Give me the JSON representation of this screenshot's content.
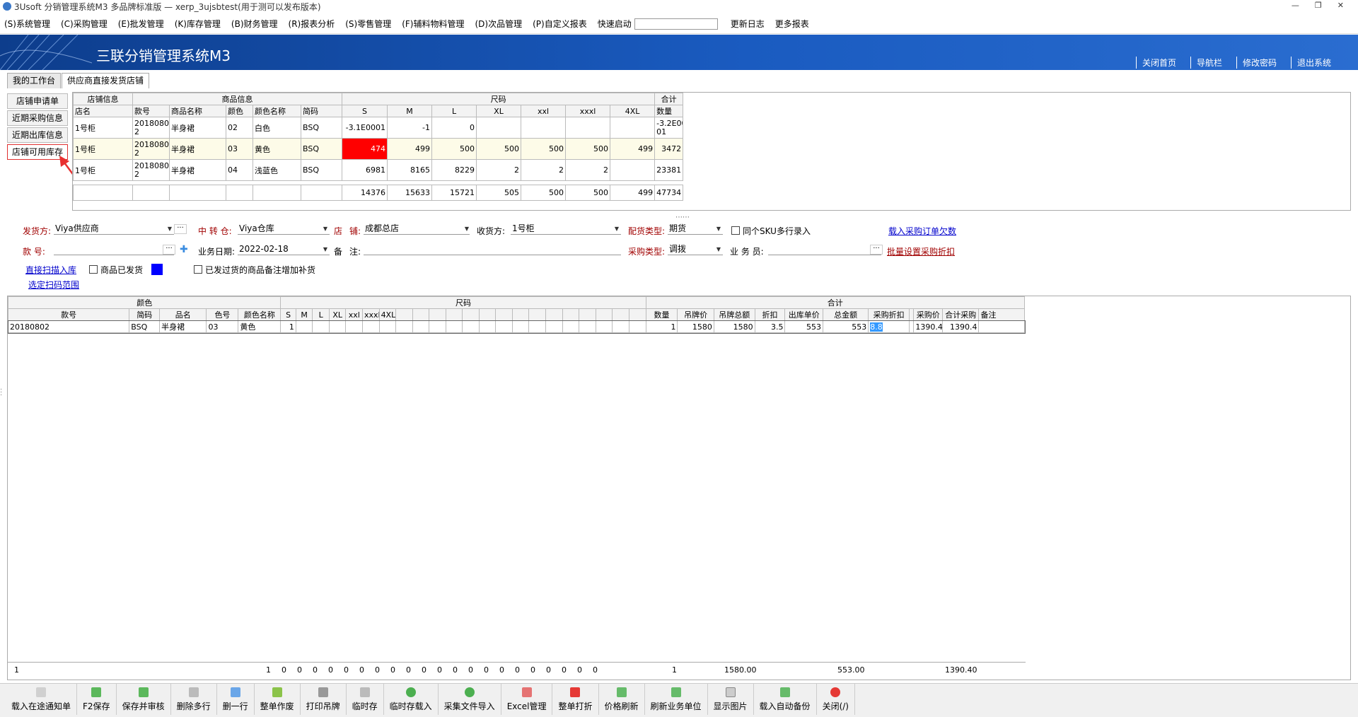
{
  "window": {
    "title": "3Usoft 分销管理系统M3 多品牌标准版 — xerp_3ujsbtest(用于测可以发布版本)"
  },
  "menu": {
    "items": [
      "(S)系统管理",
      "(C)采购管理",
      "(E)批发管理",
      "(K)库存管理",
      "(B)财务管理",
      "(R)报表分析",
      "(S)零售管理",
      "(F)辅料物料管理",
      "(D)次品管理",
      "(P)自定义报表"
    ],
    "quick_start": "快速启动",
    "update_log": "更新日志",
    "more_reports": "更多报表"
  },
  "banner": {
    "title": "三联分销管理系统M3",
    "links": [
      "关闭首页",
      "导航栏",
      "修改密码",
      "退出系统"
    ]
  },
  "tabs": [
    "我的工作台",
    "供应商直接发货店铺"
  ],
  "side": {
    "buttons": [
      "店铺申请单",
      "近期采购信息",
      "近期出库信息",
      "店铺可用库存"
    ],
    "selected": 3
  },
  "stock_grid": {
    "groups": [
      "店铺信息",
      "商品信息",
      "尺码",
      "合计"
    ],
    "headers": [
      "店名",
      "款号",
      "商品名称",
      "颜色",
      "颜色名称",
      "简码",
      "S",
      "M",
      "L",
      "XL",
      "xxl",
      "xxxl",
      "4XL",
      "数量"
    ],
    "rows": [
      [
        "1号柜",
        "2018080\n2",
        "半身裙",
        "02",
        "白色",
        "BSQ",
        "-3.1E0001",
        "-1",
        "0",
        "",
        "",
        "",
        "",
        "-3.2E00\n01"
      ],
      [
        "1号柜",
        "2018080\n2",
        "半身裙",
        "03",
        "黄色",
        "BSQ",
        "474",
        "499",
        "500",
        "500",
        "500",
        "500",
        "499",
        "3472"
      ],
      [
        "1号柜",
        "2018080\n2",
        "半身裙",
        "04",
        "浅蓝色",
        "BSQ",
        "6981",
        "8165",
        "8229",
        "2",
        "2",
        "2",
        "",
        "23381"
      ]
    ],
    "totals": [
      "",
      "",
      "",
      "",
      "",
      "",
      "14376",
      "15633",
      "15721",
      "505",
      "500",
      "500",
      "499",
      "47734"
    ]
  },
  "form": {
    "shipper_label": "发货方:",
    "shipper_value": "Viya供应商",
    "transit_label": "中 转 仓:",
    "transit_value": "Viya仓库",
    "store_label": "店",
    "store_label2": "铺:",
    "store_value": "成都总店",
    "receiver_label": "收货方:",
    "receiver_value": "1号柜",
    "dist_type_label": "配货类型:",
    "dist_type_value": "期货",
    "sku_multi_label": "同个SKU多行录入",
    "load_order_link": "载入采购订单欠数",
    "style_label": "款     号:",
    "style_value": "",
    "biz_date_label": "业务日期:",
    "biz_date_value": "2022-02-18",
    "remark_label": "备",
    "remark_label2": "注:",
    "remark_value": "",
    "purchase_type_label": "采购类型:",
    "purchase_type_value": "调拨",
    "clerk_label": "业 务 员:",
    "clerk_value": "",
    "batch_discount_link": "批量设置采购折扣",
    "scan_link": "直接扫描入库",
    "shipped_label": "商品已发货",
    "replenish_label": "已发过货的商品备注增加补货",
    "scan_range_link": "选定扫码范围"
  },
  "main_grid": {
    "groups": [
      "颜色",
      "尺码",
      "合计"
    ],
    "headers": [
      "款号",
      "简码",
      "品名",
      "色号",
      "颜色名称",
      "S",
      "M",
      "L",
      "XL",
      "xxl",
      "xxxl",
      "4XL",
      "",
      "",
      "",
      "",
      "",
      "",
      "",
      "",
      "",
      "",
      "",
      "",
      "",
      "",
      "",
      "数量",
      "吊牌价",
      "吊牌总额",
      "折扣",
      "出库单价",
      "总金额",
      "采购折扣",
      "采购价",
      "合计采购",
      "备注"
    ],
    "row": [
      "20180802",
      "BSQ",
      "半身裙",
      "03",
      "黄色",
      "1",
      "",
      "",
      "",
      "",
      "",
      "",
      "",
      "",
      "",
      "",
      "",
      "",
      "",
      "",
      "",
      "",
      "",
      "",
      "",
      "",
      "",
      "1",
      "1580",
      "1580",
      "3.5",
      "553",
      "553",
      "8.8",
      "",
      "1390.4",
      "1390.4",
      ""
    ],
    "totals": {
      "count": "1",
      "sizes": [
        "1",
        "0",
        "0",
        "0",
        "0",
        "0",
        "0",
        "0",
        "0",
        "0",
        "0",
        "0",
        "0",
        "0",
        "0",
        "0",
        "0",
        "0",
        "0",
        "0",
        "0",
        "0"
      ],
      "qty": "1",
      "tag_total": "1580.00",
      "amount": "553.00",
      "purchase_total": "1390.40"
    }
  },
  "toolbar": [
    "载入在途通知单",
    "F2保存",
    "保存并审核",
    "删除多行",
    "删一行",
    "整单作废",
    "打印吊牌",
    "临时存",
    "临时存载入",
    "采集文件导入",
    "Excel管理",
    "整单打折",
    "价格刷新",
    "刷新业务单位",
    "显示图片",
    "载入自动备份",
    "关闭(/)"
  ],
  "colors": {
    "accent": "#1a5bc0",
    "selected_cell": "#ff0000",
    "shipped_swatch": "#0000ff"
  }
}
